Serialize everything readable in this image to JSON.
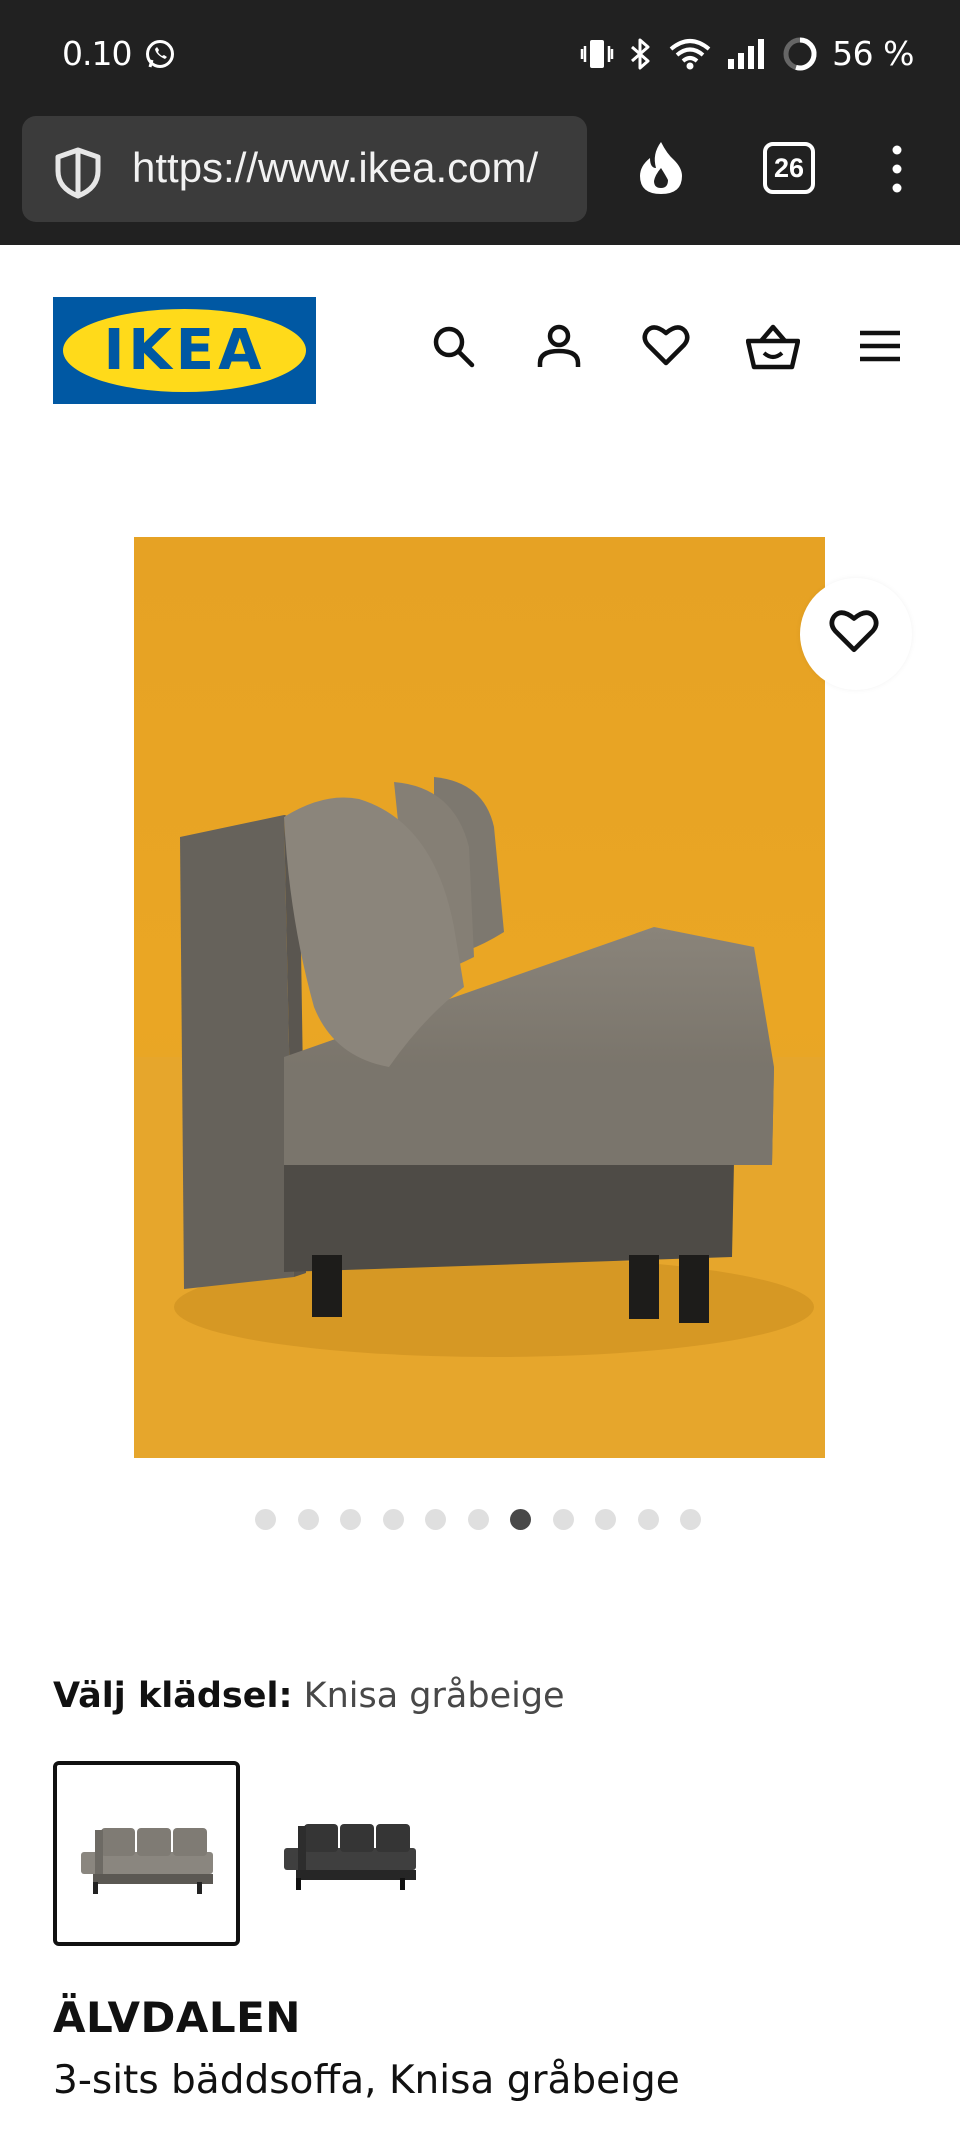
{
  "status_bar": {
    "time": "0.10",
    "battery": "56 %",
    "icons": [
      "whatsapp-icon",
      "vibrate-icon",
      "bluetooth-icon",
      "wifi-icon",
      "signal-icon",
      "battery-icon"
    ]
  },
  "browser": {
    "url": "https://www.ikea.com/",
    "tab_count": "26",
    "icons": [
      "shield-icon",
      "fire-icon",
      "more-vert-icon"
    ]
  },
  "header": {
    "logo_text": "IKEA",
    "brand_colors": {
      "blue": "#0058a3",
      "yellow": "#ffda1a"
    },
    "icons": [
      "search-icon",
      "account-icon",
      "heart-icon",
      "cart-icon",
      "hamburger-icon"
    ]
  },
  "gallery": {
    "dot_count": 11,
    "active_index": 6,
    "background_color": "#eaa826"
  },
  "product": {
    "upholstery_label": "Välj klädsel:",
    "upholstery_value": "Knisa gråbeige",
    "swatches": [
      {
        "color": "#7b7771",
        "selected": true
      },
      {
        "color": "#3e3e3e",
        "selected": false
      }
    ],
    "name": "ÄLVDALEN",
    "description": "3-sits bäddsoffa, Knisa gråbeige"
  }
}
